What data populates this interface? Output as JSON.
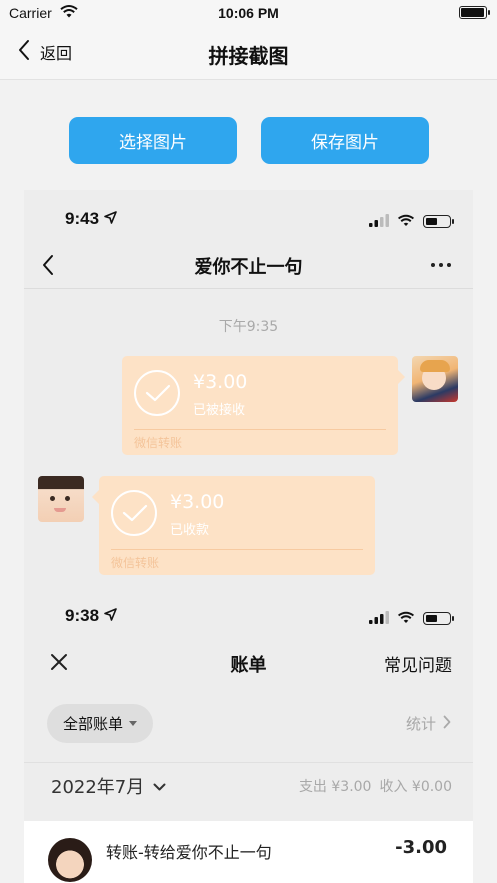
{
  "status_bar": {
    "carrier": "Carrier",
    "time": "10:06 PM",
    "battery_level": 1.0
  },
  "nav": {
    "back_label": "返回",
    "title": "拼接截图"
  },
  "actions": {
    "select_label": "选择图片",
    "save_label": "保存图片"
  },
  "chat_screenshot": {
    "time": "9:43",
    "battery_level": 0.45,
    "title": "爱你不止一句",
    "timestamp": "下午9:35",
    "messages": [
      {
        "side": "right",
        "amount": "¥3.00",
        "status": "已被接收",
        "type_label": "微信转账"
      },
      {
        "side": "left",
        "amount": "¥3.00",
        "status": "已收款",
        "type_label": "微信转账"
      }
    ]
  },
  "bill_screenshot": {
    "time": "9:38",
    "title": "账单",
    "faq_label": "常见问题",
    "filter_label": "全部账单",
    "stats_label": "统计",
    "month_label": "2022年7月",
    "expense_label": "支出 ¥3.00",
    "income_label": "收入 ¥0.00",
    "rows": [
      {
        "title": "转账-转给爱你不止一句",
        "amount": "-3.00"
      }
    ]
  },
  "colors": {
    "accent": "#2fa6ee",
    "bubble": "#fde2c6"
  }
}
